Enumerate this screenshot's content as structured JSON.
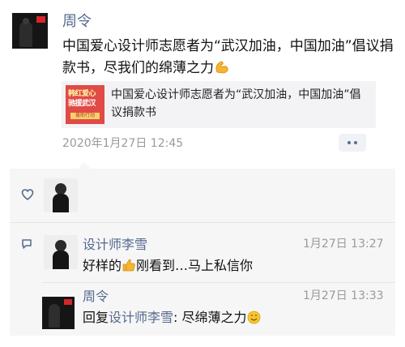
{
  "post": {
    "author": "周令",
    "text": "中国爱心设计师志愿者为“武汉加油，中国加油”倡议捐款书，尽我们的绵薄之力",
    "share": {
      "thumb_line1": "韩红爱心",
      "thumb_line2": "驰援武汉",
      "thumb_line3": "援助行动",
      "title": "中国爱心设计师志愿者为“武汉加油，中国加油”倡议捐款书"
    },
    "timestamp": "2020年1月27日 12:45"
  },
  "comments": [
    {
      "name": "设计师李雪",
      "time": "1月27日 13:27",
      "text_before": "好样的",
      "text_after": "刚看到…马上私信你"
    },
    {
      "name": "周令",
      "time": "1月27日 13:33",
      "reply_prefix": "回复",
      "reply_to": "设计师李雪",
      "text": ": 尽绵薄之力"
    }
  ],
  "colors": {
    "link": "#56698f",
    "panel": "#f6f6f6",
    "muted": "#9a9a9a"
  },
  "icons": [
    "muscle-emoji",
    "like-heart-icon",
    "comment-icon",
    "thumbs-up-emoji",
    "smile-emoji",
    "more-dots-icon"
  ]
}
